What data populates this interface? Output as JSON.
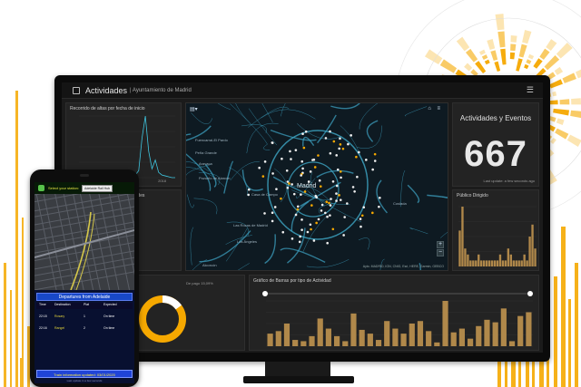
{
  "dashboard": {
    "title": "Actividades",
    "org": "| Ayuntamiento de Madrid",
    "menu_icon": "hamburger-menu-icon",
    "app_icon": "dashboard-app-icon"
  },
  "panels": {
    "line_title": "Recorrido de altas por fecha de inicio",
    "line_x_label": "2018",
    "line_values": [
      0,
      0,
      0,
      0,
      1,
      0,
      0,
      0,
      0,
      0,
      0,
      1,
      0,
      0,
      0,
      2,
      1,
      3,
      8,
      45,
      70,
      30,
      10,
      20,
      6,
      3,
      2,
      1,
      0,
      0
    ],
    "mid_left_title": "... ades",
    "kpi_title": "Actividades y Eventos",
    "kpi_value": "667",
    "kpi_updated": "Last update: a few seconds ago",
    "public_title": "Público Dirigido",
    "public_values": [
      6,
      10,
      3,
      2,
      1,
      1,
      1,
      2,
      1,
      1,
      1,
      1,
      1,
      1,
      1,
      2,
      1,
      1,
      3,
      2,
      1,
      1,
      1,
      1,
      2,
      1,
      5,
      7,
      3
    ],
    "donut_note": "De pago 15,09%",
    "donut_pct": 0.15,
    "bar_title": "Gráfico de Barras por tipo de Actividad",
    "bar_values": [
      10,
      12,
      18,
      5,
      4,
      8,
      22,
      14,
      8,
      4,
      26,
      13,
      10,
      5,
      20,
      14,
      10,
      18,
      20,
      12,
      3,
      36,
      11,
      14,
      6,
      16,
      21,
      19,
      30,
      4,
      24,
      27
    ]
  },
  "map": {
    "labels": [
      {
        "text": "Madrid",
        "big": true
      },
      {
        "text": "Fuencarral-El Pardo"
      },
      {
        "text": "Peña Grande"
      },
      {
        "text": "Aravaca"
      },
      {
        "text": "Pozuelo de Alarcón"
      },
      {
        "text": "Casa de Campo"
      },
      {
        "text": "Las Rozas de Madrid"
      },
      {
        "text": "Los Ángeles"
      },
      {
        "text": "Coslada"
      },
      {
        "text": "Alcorcón"
      }
    ],
    "attribution": "Ayto. MADRID, IGN, CNIG, Esri, HERE, Garmin, GEBCO",
    "zoom_in": "+",
    "zoom_out": "−"
  },
  "phone": {
    "station_label": "Select your station:",
    "station_value": "Adelaide Rail Hub",
    "departures_title": "Departures from Adelaide",
    "columns": [
      "Time",
      "Destination",
      "Plat",
      "Expected"
    ],
    "rows": [
      {
        "time": "22:15",
        "dest": "Rosary",
        "plat": "1",
        "expected": "On time"
      },
      {
        "time": "22:16",
        "dest": "Rangel",
        "plat": "2",
        "expected": "On time"
      }
    ],
    "footer": "Train information updated: 03/01/2020",
    "credit": "Last update in a few seconds"
  },
  "colors": {
    "accent": "#F5A800",
    "map_road": "#3fa7c7",
    "phone_header": "#1848c8"
  }
}
